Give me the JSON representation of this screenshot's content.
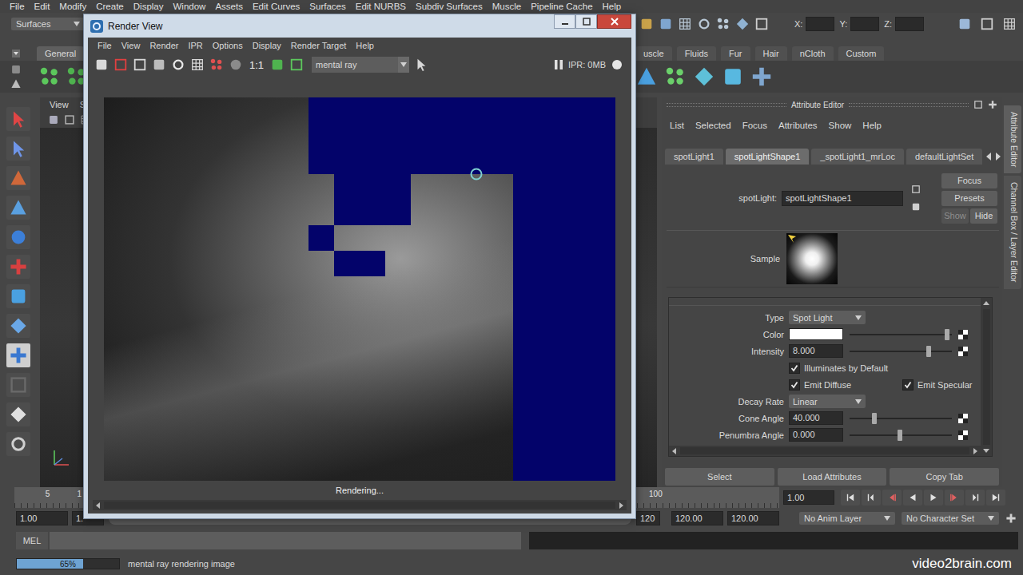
{
  "menubar": [
    "File",
    "Edit",
    "Modify",
    "Create",
    "Display",
    "Window",
    "Assets",
    "Edit Curves",
    "Surfaces",
    "Edit NURBS",
    "Subdiv Surfaces",
    "Muscle",
    "Pipeline Cache",
    "Help"
  ],
  "status_line": {
    "menu_set": "Surfaces",
    "coords": [
      {
        "label": "X:",
        "value": ""
      },
      {
        "label": "Y:",
        "value": ""
      },
      {
        "label": "Z:",
        "value": ""
      }
    ]
  },
  "shelf": {
    "tabs_left": [
      {
        "label": "General",
        "selected": true
      }
    ],
    "tabs_right": [
      {
        "label": "uscle",
        "selected": false
      },
      {
        "label": "Fluids",
        "selected": false
      },
      {
        "label": "Fur",
        "selected": false
      },
      {
        "label": "Hair",
        "selected": false
      },
      {
        "label": "nCloth",
        "selected": false
      },
      {
        "label": "Custom",
        "selected": false
      }
    ]
  },
  "toolbox": [
    {
      "selected": false
    },
    {
      "selected": false
    },
    {
      "selected": false
    },
    {
      "selected": false
    },
    {
      "selected": false
    },
    {
      "selected": false
    },
    {
      "selected": false
    },
    {
      "selected": false
    },
    {
      "selected": true
    },
    {
      "selected": false
    },
    {
      "selected": false
    },
    {
      "selected": false
    }
  ],
  "viewport": {
    "menu": [
      "View",
      "Sh"
    ]
  },
  "attribute_editor": {
    "title": "Attribute Editor",
    "menu": [
      "List",
      "Selected",
      "Focus",
      "Attributes",
      "Show",
      "Help"
    ],
    "tabs": [
      {
        "label": "spotLight1",
        "selected": false
      },
      {
        "label": "spotLightShape1",
        "selected": true
      },
      {
        "label": "_spotLight1_mrLoc",
        "selected": false
      },
      {
        "label": "defaultLightSet",
        "selected": false
      }
    ],
    "node": {
      "label": "spotLight:",
      "value": "spotLightShape1"
    },
    "buttons": [
      {
        "label": "Focus",
        "disabled": false
      },
      {
        "label": "Presets",
        "disabled": false
      }
    ],
    "visibility": [
      {
        "label": "Show",
        "disabled": true
      },
      {
        "label": "Hide",
        "disabled": false
      }
    ],
    "sample": {
      "label": "Sample"
    },
    "attributes": [
      {
        "kind": "dropdown",
        "label": "Type",
        "value": "Spot Light"
      },
      {
        "kind": "color",
        "label": "Color",
        "swatch": "#ffffff",
        "level": 0.95
      },
      {
        "kind": "slider",
        "label": "Intensity",
        "value": "8.000",
        "level": 0.77
      },
      {
        "kind": "checkboxes",
        "boxes": [
          {
            "label": "Illuminates by Default",
            "checked": true
          }
        ]
      },
      {
        "kind": "checkboxes",
        "boxes": [
          {
            "label": "Emit Diffuse",
            "checked": true
          },
          {
            "label": "Emit Specular",
            "checked": true
          }
        ]
      },
      {
        "kind": "dropdown",
        "label": "Decay Rate",
        "value": "Linear"
      },
      {
        "kind": "slider",
        "label": "Cone Angle",
        "value": "40.000",
        "level": 0.24
      },
      {
        "kind": "slider",
        "label": "Penumbra Angle",
        "value": "0.000",
        "level": 0.49
      }
    ],
    "footer": [
      "Select",
      "Load Attributes",
      "Copy Tab"
    ]
  },
  "side_tabs": [
    {
      "label": "Attribute Editor",
      "selected": true
    },
    {
      "label": "Channel Box / Layer Editor",
      "selected": false
    }
  ],
  "time_slider": {
    "ticks": [
      "5",
      "1",
      "100"
    ],
    "current_time": "1.00"
  },
  "range_slider": {
    "start": "1.00",
    "inner_start": "1.",
    "inner_end": "120",
    "end": "120.00",
    "max_end": "120.00",
    "anim_layer": "No Anim Layer",
    "character_set": "No Character Set"
  },
  "command_line": {
    "language": "MEL",
    "input": "",
    "result": ""
  },
  "help_line": {
    "progress": {
      "level": 0.65,
      "label": "65%"
    },
    "message": "mental ray rendering image"
  },
  "watermark": "video2brain.com",
  "render_view": {
    "title": "Render View",
    "menu": [
      "File",
      "View",
      "Render",
      "IPR",
      "Options",
      "Display",
      "Render Target",
      "Help"
    ],
    "zoom": "1:1",
    "renderer": "mental ray",
    "ipr_memory": "IPR: 0MB",
    "status": "Rendering..."
  }
}
